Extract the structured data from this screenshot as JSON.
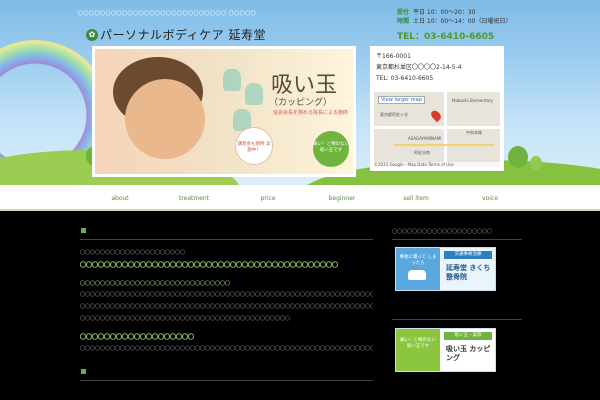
{
  "header": {
    "tagline": "〇〇〇〇〇〇〇〇〇〇〇〇〇〇〇〇〇〇〇〇〇〇〇〇〇〇〇 〇〇〇〇〇",
    "logo_text": "パーソナルボディケア 延寿堂",
    "hours": [
      {
        "key": "受付",
        "val": "平日 10：00～20：30"
      },
      {
        "key": "時間",
        "val": "土日 10：00～14：00（日曜祝日）"
      }
    ],
    "tel": "TEL：03-6410-6605"
  },
  "banner": {
    "title": "吸い玉",
    "subtitle": "（カッピング）",
    "desc": "協会会長を務める院長による施術",
    "bubble1": "講習会も随時 実施中！",
    "bubble2": "痛い！と噂のない 吸い玉です"
  },
  "contact": {
    "postal": "〒166-0001",
    "address": "東京都杉並区〇〇〇〇2-14-5-4",
    "tel": "TEL: 03-6410-6605",
    "map_link": "View larger map",
    "map_footer": "©2015 Google - Map Data   Terms of Use",
    "map_labels": [
      "東京都阿佐ヶ谷",
      "ASAGAYAMINAMI",
      "阿佐谷南",
      "Mabashi Elementary",
      "中央本線"
    ]
  },
  "nav": {
    "items": [
      "about",
      "treatment",
      "price",
      "beginner",
      "sell item",
      "voice"
    ]
  },
  "content": {
    "intro": "〇〇〇〇〇〇〇〇〇〇〇〇〇〇〇〇〇〇〇〇〇",
    "headline1": "〇〇〇〇〇〇〇〇〇〇〇〇〇〇〇〇〇〇〇〇〇〇〇〇〇〇〇〇〇〇〇〇〇〇〇〇〇〇〇〇〇〇〇",
    "sub1": "〇〇〇〇〇〇〇〇〇〇〇〇〇〇〇〇〇〇〇〇〇〇〇〇〇〇〇〇〇〇",
    "para1": "〇〇〇〇〇〇〇〇〇〇〇〇〇〇〇〇〇〇〇〇〇〇〇〇〇〇〇〇〇〇〇〇〇〇〇〇〇〇〇〇〇〇〇〇〇〇〇〇〇〇〇〇〇〇〇〇〇〇〇〇〇〇〇〇〇〇〇〇〇〇〇〇〇〇〇〇〇〇〇〇〇〇〇〇〇〇",
    "para2": "〇〇〇〇〇〇〇〇〇〇〇〇〇〇〇〇〇〇〇〇〇〇〇〇〇〇〇〇〇〇〇〇〇〇〇〇〇〇〇〇〇〇〇〇〇〇〇〇〇〇〇〇〇〇〇〇〇〇〇〇〇〇〇〇〇〇〇〇〇〇〇〇〇〇〇〇〇〇〇〇〇〇〇〇〇〇〇",
    "para3": "〇〇〇〇〇〇〇〇〇〇〇〇〇〇〇〇〇〇〇〇〇〇〇〇〇〇〇〇〇〇〇〇〇〇〇〇〇〇〇〇〇〇",
    "headline2": "〇〇〇〇〇〇〇〇〇〇〇〇〇〇〇〇〇〇〇",
    "para4": "〇〇〇〇〇〇〇〇〇〇〇〇〇〇〇〇〇〇〇〇〇〇〇〇〇〇〇〇〇〇〇〇〇〇〇〇〇〇〇〇〇〇〇〇〇〇〇〇〇〇〇〇〇〇〇〇〇〇〇〇〇〇〇〇〇〇〇〇〇〇〇〇〇〇〇〇〇〇〇〇〇〇〇〇〇〇〇〇〇〇〇〇〇〇〇〇〇〇〇〇〇〇〇〇〇〇〇〇〇〇〇〇〇〇"
  },
  "sidebar": {
    "heading": "〇〇〇〇〇〇〇〇〇〇〇〇〇〇〇〇〇〇〇〇",
    "banner1": {
      "tag": "交通事故治療",
      "left": "事故に遭って しまったら",
      "name": "延寿堂 きくち整骨院"
    },
    "banner2": {
      "tag": "吸い玉・美容",
      "left": "痛い！と噂のない 吸い玉です",
      "name": "吸い玉 カッピング"
    }
  },
  "colors": {
    "accent": "#5ab54a",
    "headline": "#a8e07a",
    "sky": "#9ccdf0",
    "nav_text": "#5a8a3a"
  }
}
